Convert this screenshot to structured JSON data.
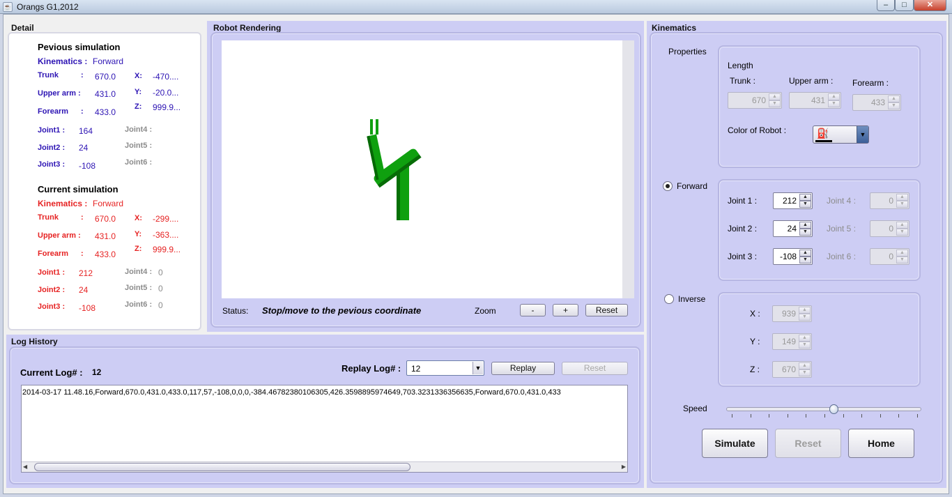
{
  "window": {
    "title": "Orangs G1,2012",
    "min": "–",
    "max": "□",
    "close": "✕"
  },
  "detail": {
    "title": "Detail",
    "previous": {
      "heading": "Pevious simulation",
      "kin_label": "Kinematics :",
      "kin_value": "Forward",
      "trunk_label": "Trunk",
      "trunk_value": "670.0",
      "upper_label": "Upper arm :",
      "upper_value": "431.0",
      "forearm_label": "Forearm",
      "forearm_value": "433.0",
      "colon": ":",
      "x_label": "X:",
      "x_value": "-470....",
      "y_label": "Y:",
      "y_value": "-20.0...",
      "z_label": "Z:",
      "z_value": "999.9...",
      "j1_label": "Joint1 :",
      "j1_value": "164",
      "j2_label": "Joint2 :",
      "j2_value": "24",
      "j3_label": "Joint3 :",
      "j3_value": "-108",
      "j4_label": "Joint4 :",
      "j5_label": "Joint5 :",
      "j6_label": "Joint6 :"
    },
    "current": {
      "heading": "Current simulation",
      "kin_label": "Kinematics :",
      "kin_value": "Forward",
      "trunk_label": "Trunk",
      "trunk_value": "670.0",
      "upper_label": "Upper arm :",
      "upper_value": "431.0",
      "forearm_label": "Forearm",
      "forearm_value": "433.0",
      "colon": ":",
      "x_label": "X:",
      "x_value": "-299....",
      "y_label": "Y:",
      "y_value": "-363....",
      "z_label": "Z:",
      "z_value": "999.9...",
      "j1_label": "Joint1 :",
      "j1_value": "212",
      "j2_label": "Joint2 :",
      "j2_value": "24",
      "j3_label": "Joint3 :",
      "j3_value": "-108",
      "j4_label": "Joint4 :",
      "j4_value": "0",
      "j5_label": "Joint5 :",
      "j5_value": "0",
      "j6_label": "Joint6 :",
      "j6_value": "0"
    }
  },
  "rendering": {
    "title": "Robot Rendering",
    "status_label": "Status:",
    "status_value": "Stop/move to the pevious coordinate",
    "zoom_label": "Zoom",
    "zoom_out": "-",
    "zoom_in": "+",
    "reset": "Reset",
    "robot_color": "#0fa00f"
  },
  "log": {
    "title": "Log History",
    "current_label": "Current Log# :",
    "current_value": "12",
    "replay_label": "Replay Log# :",
    "replay_selected": "12",
    "replay_button": "Replay",
    "reset_button": "Reset",
    "text": "2014-03-17 11.48.16,Forward,670.0,431.0,433.0,117,57,-108,0,0,0,-384.46782380106305,426.3598895974649,703.3231336356635,Forward,670.0,431.0,433"
  },
  "kinematics": {
    "title": "Kinematics",
    "properties_label": "Properties",
    "length_label": "Length",
    "trunk_label": "Trunk :",
    "trunk_value": "670",
    "upper_label": "Upper arm :",
    "upper_value": "431",
    "forearm_label": "Forearm :",
    "forearm_value": "433",
    "color_label": "Color of Robot :",
    "forward_label": "Forward",
    "inverse_label": "Inverse",
    "joint1_label": "Joint 1 :",
    "joint1_value": "212",
    "joint2_label": "Joint 2 :",
    "joint2_value": "24",
    "joint3_label": "Joint 3 :",
    "joint3_value": "-108",
    "joint4_label": "Joint 4 :",
    "joint4_value": "0",
    "joint5_label": "Joint 5 :",
    "joint5_value": "0",
    "joint6_label": "Joint 6 :",
    "joint6_value": "0",
    "x_label": "X :",
    "x_value": "939",
    "y_label": "Y :",
    "y_value": "149",
    "z_label": "Z :",
    "z_value": "670",
    "speed_label": "Speed",
    "speed_level": 0.55,
    "simulate_button": "Simulate",
    "reset_button": "Reset",
    "home_button": "Home"
  }
}
